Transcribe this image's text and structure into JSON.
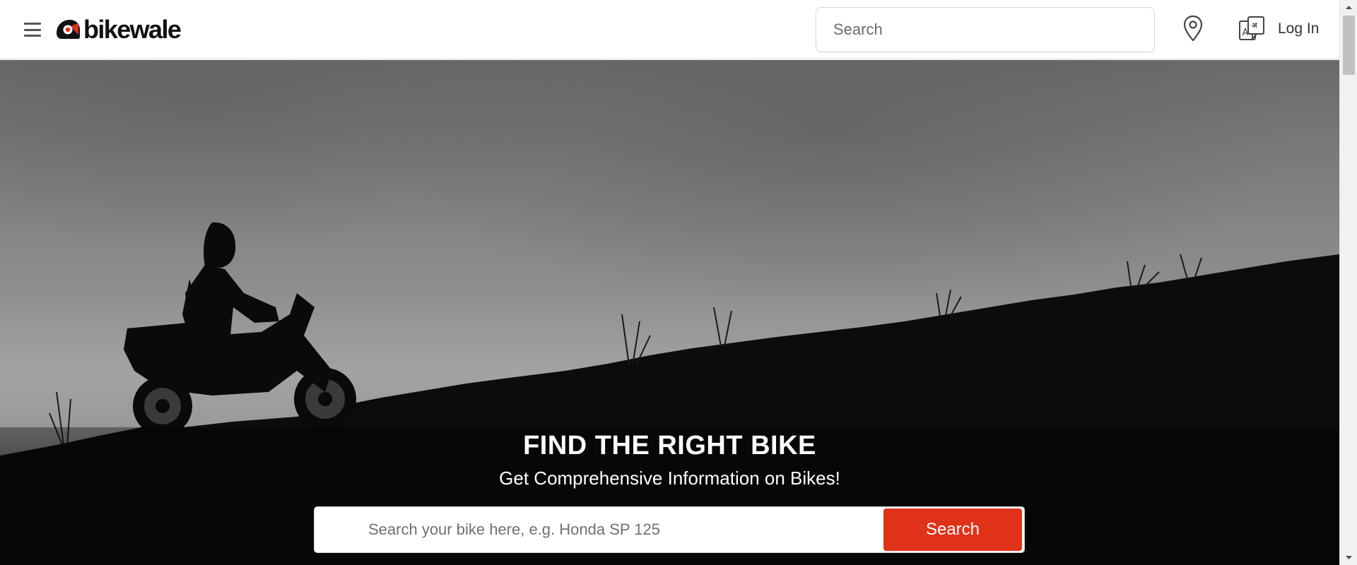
{
  "header": {
    "logo_text": "bikewale",
    "search_placeholder": "Search",
    "login_label": "Log In",
    "icons": [
      "hamburger-menu-icon",
      "location-pin-icon",
      "language-translate-icon"
    ]
  },
  "hero": {
    "title": "FIND THE RIGHT BIKE",
    "subtitle": "Get Comprehensive Information on Bikes!",
    "search_placeholder": "Search your bike here, e.g. Honda SP 125",
    "search_button_label": "Search"
  },
  "colors": {
    "brand_red": "#e03218",
    "header_bg": "#ffffff",
    "text_dark": "#333333"
  }
}
